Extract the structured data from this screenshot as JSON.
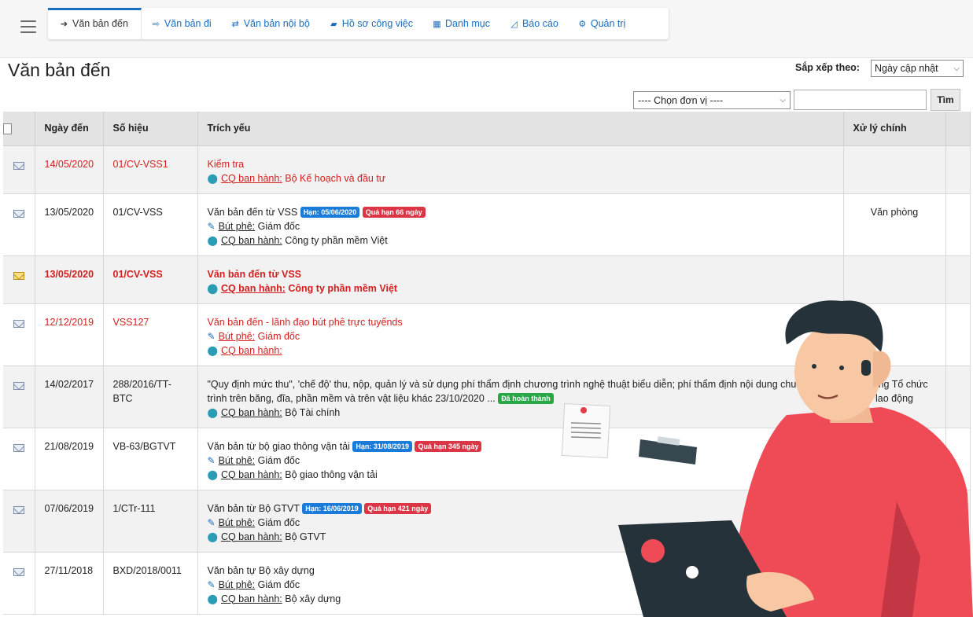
{
  "nav": {
    "tabs": [
      {
        "label": "Văn bản đến",
        "icon": "sign-in-icon",
        "active": true
      },
      {
        "label": "Văn bản đi",
        "icon": "sign-out-icon"
      },
      {
        "label": "Văn bản nội bộ",
        "icon": "exchange-icon"
      },
      {
        "label": "Hồ sơ công việc",
        "icon": "folder-icon"
      },
      {
        "label": "Danh mục",
        "icon": "table-icon"
      },
      {
        "label": "Báo cáo",
        "icon": "chart-icon"
      },
      {
        "label": "Quản trị",
        "icon": "gears-icon"
      }
    ]
  },
  "page": {
    "title": "Văn bản đến",
    "sort_label": "Sắp xếp theo:",
    "sort_value": "Ngày cập nhật",
    "unit_select": "---- Chọn đơn vị ----",
    "search_value": "",
    "search_button": "Tìm"
  },
  "table": {
    "headers": [
      "Ngày đến",
      "Số hiệu",
      "Trích yếu",
      "Xử lý chính"
    ],
    "labels": {
      "but_phe": "Bút phê:",
      "cq_ban_hanh": "CQ ban hành:"
    },
    "rows": [
      {
        "date": "14/05/2020",
        "number": "01/CV-VSS1",
        "title": "Kiểm tra",
        "issuer": "Bộ Kế hoạch và đầu tư",
        "handler": "",
        "style": "red",
        "shaded": true,
        "envelope": "blue"
      },
      {
        "date": "13/05/2020",
        "number": "01/CV-VSS",
        "title": "Văn bản đến từ VSS",
        "deadline": "Hạn: 05/06/2020",
        "overdue": "Quá hạn 66 ngày",
        "approver": "Giám đốc",
        "issuer": "Công ty phần mềm Việt",
        "handler": "Văn phòng",
        "style": "normal",
        "shaded": false,
        "envelope": "blue"
      },
      {
        "date": "13/05/2020",
        "number": "01/CV-VSS",
        "title": "Văn bản đến từ VSS",
        "issuer": "Công ty phần mềm Việt",
        "handler": "",
        "style": "redbold",
        "shaded": true,
        "envelope": "yellow"
      },
      {
        "date": "12/12/2019",
        "number": "VSS127",
        "title": "Văn bản đến - lãnh đạo bút phê trực tuyếnds",
        "approver": "Giám đốc",
        "issuer": "",
        "handler": "",
        "style": "red",
        "shaded": false,
        "envelope": "blue"
      },
      {
        "date": "14/02/2017",
        "number": "288/2016/TT-BTC",
        "title": "\"Quy định mức thu\", 'chế độ' thu, nộp, quản lý và sử dụng phí thẩm định chương trình nghệ thuật biểu diễn; phí thẩm định nội dung chương trình trên băng, đĩa, phần mềm và trên vật liệu khác 23/10/2020 ...",
        "done": "Đã hoàn thành",
        "issuer": "Bộ Tài chính",
        "handler": "Phòng Tổ chức lao động",
        "style": "normal",
        "shaded": true,
        "envelope": "blue"
      },
      {
        "date": "21/08/2019",
        "number": "VB-63/BGTVT",
        "title": "Văn bản từ bộ giao thông vận tải",
        "deadline": "Hạn: 31/08/2019",
        "overdue": "Quá hạn 345 ngày",
        "approver": "Giám đốc",
        "issuer": "Bộ giao thông vận tải",
        "handler": "",
        "style": "normal",
        "shaded": false,
        "envelope": "blue"
      },
      {
        "date": "07/06/2019",
        "number": "1/CTr-111",
        "title": "Văn bản từ Bộ GTVT",
        "deadline": "Hạn: 16/06/2019",
        "overdue": "Quá hạn 421 ngày",
        "approver": "Giám đốc",
        "issuer": "Bộ GTVT",
        "handler": "",
        "style": "normal",
        "shaded": true,
        "envelope": "blue"
      },
      {
        "date": "27/11/2018",
        "number": "BXD/2018/0011",
        "title": "Văn bản tự Bộ xây dựng",
        "approver": "Giám đốc",
        "issuer": "Bộ xây dựng",
        "handler": "",
        "style": "normal",
        "shaded": false,
        "envelope": "blue"
      }
    ]
  },
  "colors": {
    "accent": "#1a6fc0",
    "overdue": "#dc3545",
    "deadline": "#1a7bd8",
    "done": "#28a745",
    "highlight_text": "#d21f1f"
  }
}
